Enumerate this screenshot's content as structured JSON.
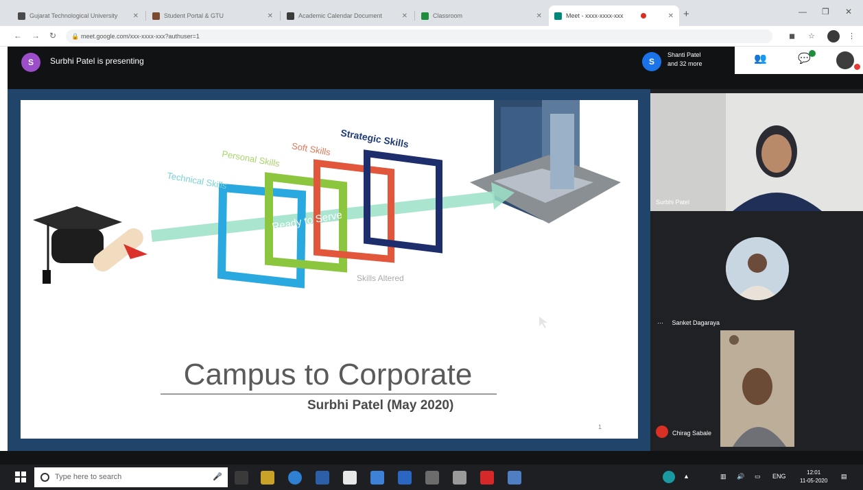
{
  "browser": {
    "tabs": [
      {
        "label": "Gujarat Technological University"
      },
      {
        "label": "Student Portal & GTU"
      },
      {
        "label": "Academic Calendar Document"
      },
      {
        "label": "Classroom"
      },
      {
        "label": "Meet - xxxx-xxxx-xxx"
      }
    ],
    "new_tab": "+",
    "url": "meet.google.com/xxx-xxxx-xxx?authuser=1",
    "nav": {
      "back": "←",
      "forward": "→",
      "reload": "↻"
    }
  },
  "meet": {
    "presenter_initial": "S",
    "presenter_text": "Surbhi Patel is presenting",
    "participants_initial": "S",
    "participants_line1": "Shanti Patel",
    "participants_line2": "and 32 more",
    "slide": {
      "title": "Campus to Corporate",
      "subtitle": "Surbhi Patel (May 2020)",
      "skills": [
        "Technical Skills",
        "Personal Skills",
        "Soft Skills",
        "Strategic Skills"
      ],
      "center_label": "Ready to Serve",
      "footer_label": "Skills Altered",
      "page_number": "1"
    },
    "tiles": [
      {
        "name": "Surbhi Patel"
      },
      {
        "name": "Sanket Dagaraya"
      },
      {
        "name": "Chirag Sabale"
      }
    ]
  },
  "taskbar": {
    "search_placeholder": "Type here to search",
    "time": "12:01",
    "date": "11-05-2020"
  },
  "colors": {
    "meet_bg": "#202124",
    "slide_frame": "#21456a",
    "presenter_avatar": "#9c4ec8",
    "participant_avatar": "#1a73e8",
    "technical": "#2aa8e0",
    "personal": "#8cc63f",
    "soft": "#e2573b",
    "strategic": "#1e2d6b"
  }
}
